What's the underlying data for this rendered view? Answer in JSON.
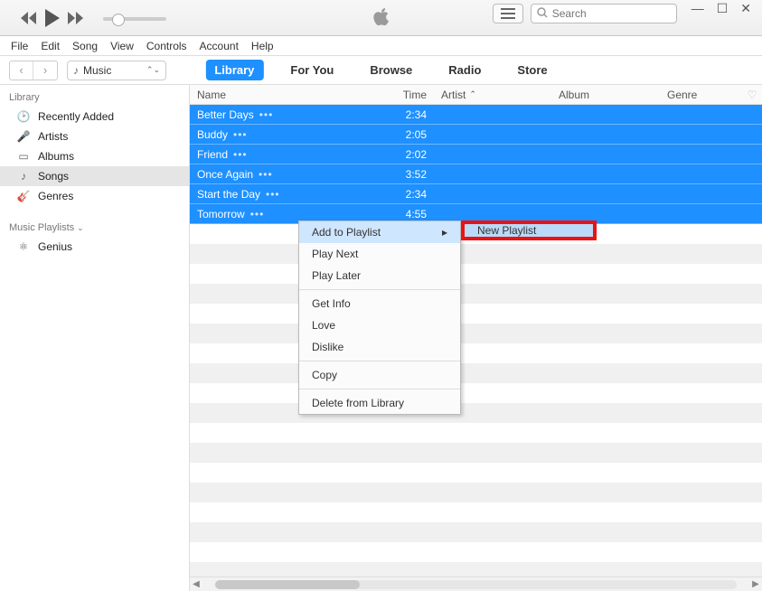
{
  "search": {
    "placeholder": "Search"
  },
  "menubar": [
    "File",
    "Edit",
    "Song",
    "View",
    "Controls",
    "Account",
    "Help"
  ],
  "media_selector": {
    "label": "Music"
  },
  "tabs": [
    {
      "label": "Library",
      "active": true
    },
    {
      "label": "For You",
      "active": false
    },
    {
      "label": "Browse",
      "active": false
    },
    {
      "label": "Radio",
      "active": false
    },
    {
      "label": "Store",
      "active": false
    }
  ],
  "sidebar": {
    "library_header": "Library",
    "items": [
      {
        "icon": "clock",
        "label": "Recently Added"
      },
      {
        "icon": "mic",
        "label": "Artists"
      },
      {
        "icon": "album",
        "label": "Albums"
      },
      {
        "icon": "note",
        "label": "Songs",
        "active": true
      },
      {
        "icon": "guitar",
        "label": "Genres"
      }
    ],
    "playlists_header": "Music Playlists",
    "playlists": [
      {
        "icon": "atom",
        "label": "Genius"
      }
    ]
  },
  "columns": {
    "name": "Name",
    "time": "Time",
    "artist": "Artist",
    "album": "Album",
    "genre": "Genre"
  },
  "rows": [
    {
      "name": "Better Days",
      "time": "2:34"
    },
    {
      "name": "Buddy",
      "time": "2:05"
    },
    {
      "name": "Friend",
      "time": "2:02"
    },
    {
      "name": "Once Again",
      "time": "3:52"
    },
    {
      "name": "Start the Day",
      "time": "2:34"
    },
    {
      "name": "Tomorrow",
      "time": "4:55"
    }
  ],
  "context_menu": {
    "items": [
      {
        "label": "Add to Playlist",
        "submenu": true,
        "highlight": true
      },
      {
        "label": "Play Next"
      },
      {
        "label": "Play Later"
      },
      {
        "sep": true
      },
      {
        "label": "Get Info"
      },
      {
        "label": "Love"
      },
      {
        "label": "Dislike"
      },
      {
        "sep": true
      },
      {
        "label": "Copy"
      },
      {
        "sep": true
      },
      {
        "label": "Delete from Library"
      }
    ],
    "submenu_item": "New Playlist"
  }
}
